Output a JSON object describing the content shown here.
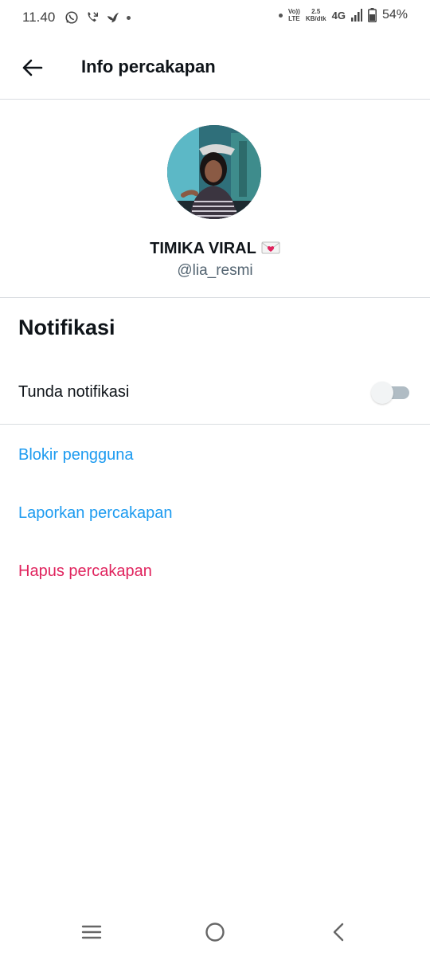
{
  "status_bar": {
    "time": "11.40",
    "left_icons": [
      "whatsapp-icon",
      "missed-call-icon",
      "bird-icon",
      "dot-icon"
    ],
    "volte_top": "Vo))",
    "volte_bottom": "LTE",
    "speed_value": "2.5",
    "speed_unit": "KB/dtk",
    "network": "4G",
    "battery_percent": "54%"
  },
  "header": {
    "title": "Info percakapan",
    "back_icon": "arrow-left-icon"
  },
  "profile": {
    "display_name": "TIMIKA VIRAL",
    "name_emoji_icon": "envelope-heart-icon",
    "handle": "@lia_resmi"
  },
  "notifications": {
    "section_title": "Notifikasi",
    "snooze_label": "Tunda notifikasi",
    "snooze_enabled": false
  },
  "actions": {
    "block": "Blokir pengguna",
    "report": "Laporkan percakapan",
    "delete": "Hapus percakapan"
  },
  "colors": {
    "link_blue": "#1d9bf0",
    "danger_red": "#e0245e",
    "divider": "#d9dde1",
    "secondary_text": "#536471"
  },
  "nav_bar": {
    "icons": [
      "menu-icon",
      "home-circle-icon",
      "back-chevron-icon"
    ]
  }
}
